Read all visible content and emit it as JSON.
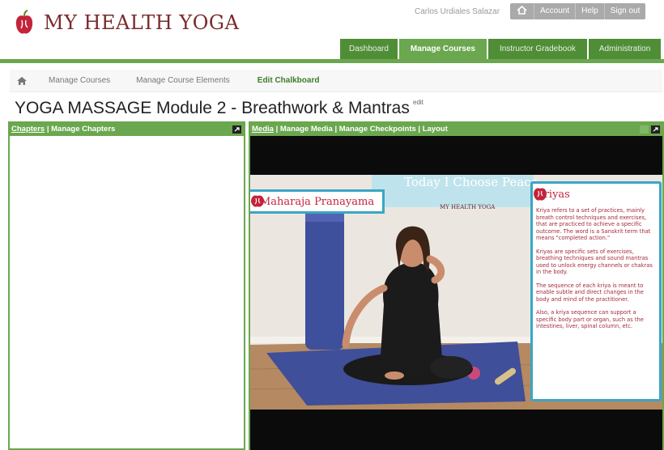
{
  "brand": {
    "name": "MY HEALTH YOGA"
  },
  "user": {
    "name": "Carlos Urdiales Salazar"
  },
  "util_menu": [
    "Account",
    "Help",
    "Sign out"
  ],
  "nav_tabs": [
    {
      "label": "Dashboard",
      "active": false
    },
    {
      "label": "Manage Courses",
      "active": true
    },
    {
      "label": "Instructor Gradebook",
      "active": false
    },
    {
      "label": "Administration",
      "active": false
    }
  ],
  "breadcrumb": [
    "Manage Courses",
    "Manage Course Elements",
    "Edit Chalkboard"
  ],
  "page": {
    "title": "YOGA MASSAGE Module 2 - Breathwork & Mantras",
    "edit_label": "edit"
  },
  "left_panel": {
    "link1": "Chapters",
    "sep": " | ",
    "link2": "Manage Chapters"
  },
  "right_panel": {
    "link1": "Media",
    "sep": " | ",
    "link2": "Manage Media",
    "link3": "Manage Checkpoints",
    "link4": "Layout"
  },
  "video": {
    "banner_text": "Today I Choose Peace",
    "brand_small": "MY HEALTH YOGA",
    "move_label": "Maharaja Pranayama",
    "card_title": "Kriyas",
    "card_paragraphs": [
      "Kriya refers to a set of practices, mainly breath control techniques and exercises, that are practiced to achieve a specific outcome. The word is a Sanskrit term that means \"completed action.\"",
      "Kriyas are specific sets of exercises, breathing techniques and sound mantras used to unlock energy channels or chakras in the body.",
      "The sequence of each kriya is meant to enable subtle and direct changes in the body and mind of the practitioner.",
      "Also, a kriya sequence can support a specific body part or organ, such as the intestines, liver, spinal column, etc."
    ]
  },
  "colors": {
    "accent_green": "#6aa74e",
    "dark_green": "#4f8e36",
    "brand_red": "#c3243b",
    "card_border": "#3aa6c4"
  },
  "icons": [
    "apple-logo-icon",
    "home-icon",
    "expand-icon"
  ]
}
